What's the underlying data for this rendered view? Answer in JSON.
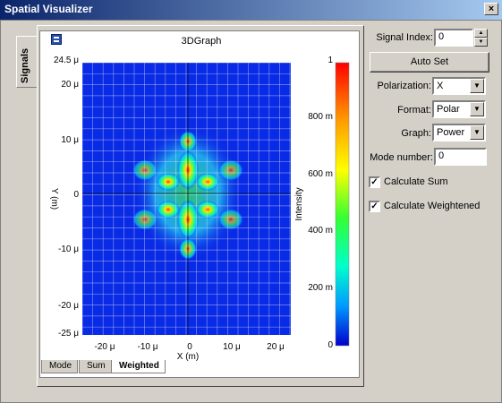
{
  "window": {
    "title": "Spatial Visualizer",
    "close_glyph": "×"
  },
  "side_tab": {
    "label": "Signals"
  },
  "graph": {
    "title": "3DGraph",
    "x_label": "X (m)",
    "y_label": "Y (m)",
    "colorbar_label": "Intensity",
    "y_top_label": "24.5 μ",
    "y_ticks": [
      "20 μ",
      "10 μ",
      "0",
      "-10 μ",
      "-20 μ",
      "-25 μ"
    ],
    "x_ticks": [
      "-20 μ",
      "-10 μ",
      "0",
      "10 μ",
      "20 μ"
    ],
    "colorbar_ticks": [
      "1",
      "800 m",
      "600 m",
      "400 m",
      "200 m",
      "0"
    ]
  },
  "bottom_tabs": [
    "Mode",
    "Sum",
    "Weighted"
  ],
  "controls": {
    "signal_index_label": "Signal Index:",
    "signal_index_value": "0",
    "auto_set_label": "Auto Set",
    "polarization_label": "Polarization:",
    "polarization_value": "X",
    "format_label": "Format:",
    "format_value": "Polar",
    "graph_label": "Graph:",
    "graph_value": "Power",
    "mode_number_label": "Mode number:",
    "mode_number_value": "0",
    "calc_sum_label": "Calculate Sum",
    "calc_sum_checked": true,
    "calc_weighted_label": "Calculate Weightened",
    "calc_weighted_checked": true
  },
  "colors": {
    "background": "#0a2be6",
    "accent": "#0a246a"
  }
}
